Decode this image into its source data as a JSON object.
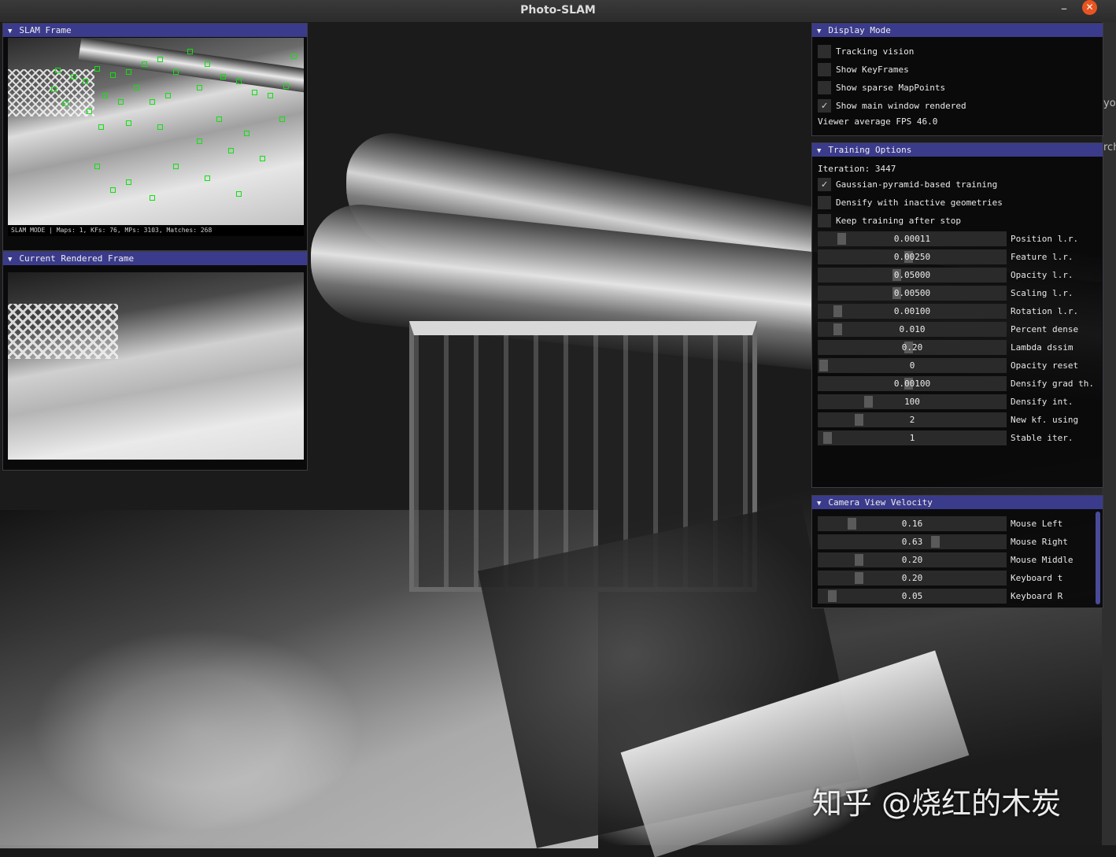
{
  "window": {
    "title": "Photo-SLAM",
    "minimize_glyph": "–",
    "close_glyph": "✕"
  },
  "watermark": "知乎 @烧红的木炭",
  "edge_hints": [
    "yo",
    "rch"
  ],
  "slam_frame": {
    "title": "SLAM Frame",
    "status_line": "SLAM MODE |  Maps: 1, KFs: 76, MPs: 3103, Matches: 268",
    "feature_color": "#10e010"
  },
  "rendered_frame": {
    "title": "Current Rendered Frame"
  },
  "display_mode": {
    "title": "Display Mode",
    "options": [
      {
        "label": "Tracking vision",
        "checked": false
      },
      {
        "label": "Show KeyFrames",
        "checked": false
      },
      {
        "label": "Show sparse MapPoints",
        "checked": false
      },
      {
        "label": "Show main window rendered",
        "checked": true
      }
    ],
    "fps_text": "Viewer average FPS 46.0"
  },
  "training_options": {
    "title": "Training Options",
    "iteration_text": "Iteration: 3447",
    "options": [
      {
        "label": "Gaussian-pyramid-based training",
        "checked": true
      },
      {
        "label": "Densify with inactive geometries",
        "checked": false
      },
      {
        "label": "Keep training after stop",
        "checked": false
      }
    ],
    "sliders": [
      {
        "value": "0.00011",
        "label": "Position l.r.",
        "level": 0.1
      },
      {
        "value": "0.00250",
        "label": "Feature l.r.",
        "level": 0.48
      },
      {
        "value": "0.05000",
        "label": "Opacity l.r.",
        "level": 0.41
      },
      {
        "value": "0.00500",
        "label": "Scaling l.r.",
        "level": 0.41
      },
      {
        "value": "0.00100",
        "label": "Rotation l.r.",
        "level": 0.08
      },
      {
        "value": "0.010",
        "label": "Percent dense",
        "level": 0.08
      },
      {
        "value": "0.20",
        "label": "Lambda dssim",
        "level": 0.48
      },
      {
        "value": "0",
        "label": "Opacity reset",
        "level": 0.0
      },
      {
        "value": "0.00100",
        "label": "Densify grad th.",
        "level": 0.48
      },
      {
        "value": "100",
        "label": "Densify int.",
        "level": 0.25
      },
      {
        "value": "2",
        "label": "New kf. using",
        "level": 0.2
      },
      {
        "value": "1",
        "label": "Stable iter.",
        "level": 0.02
      }
    ]
  },
  "camera_velocity": {
    "title": "Camera View Velocity",
    "sliders": [
      {
        "value": "0.16",
        "label": "Mouse Left",
        "level": 0.16
      },
      {
        "value": "0.63",
        "label": "Mouse Right",
        "level": 0.63
      },
      {
        "value": "0.20",
        "label": "Mouse Middle",
        "level": 0.2
      },
      {
        "value": "0.20",
        "label": "Keyboard t",
        "level": 0.2
      },
      {
        "value": "0.05",
        "label": "Keyboard R",
        "level": 0.05
      }
    ]
  },
  "icons": {
    "collapse": "triangle-down",
    "check": "checkmark"
  }
}
